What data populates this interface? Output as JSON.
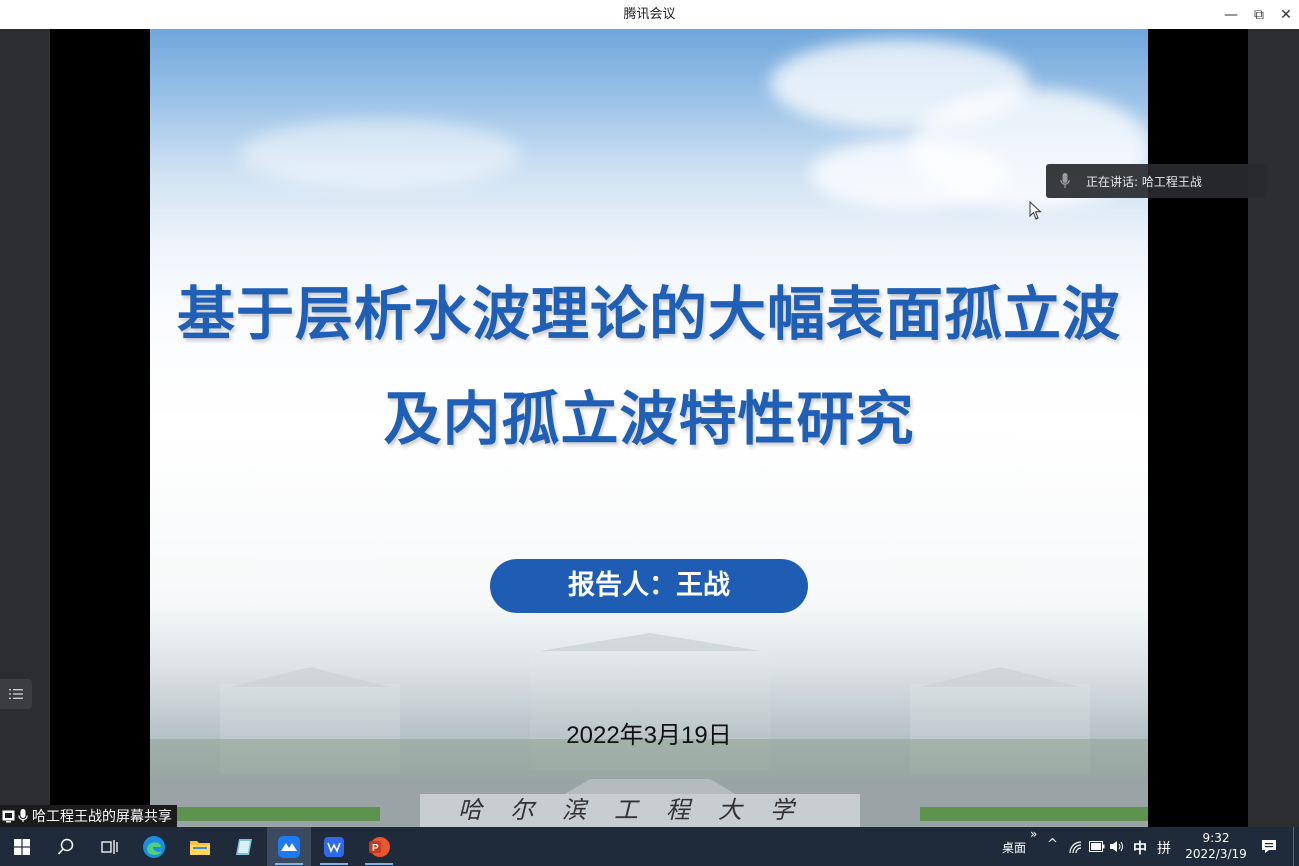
{
  "window": {
    "title": "腾讯会议",
    "minimize_glyph": "—",
    "maximize_glyph": "⧉",
    "close_glyph": "✕"
  },
  "slide": {
    "title_line1": "基于层析水波理论的大幅表面孤立波",
    "title_line2": "及内孤立波特性研究",
    "reporter": "报告人：王战",
    "date": "2022年3月19日",
    "campus_sign": "哈尔滨工程大学",
    "title_color": "#1f5fb5",
    "pill_color": "#1e5db3"
  },
  "meeting": {
    "speaking_text": "正在讲话: 哈工程王战",
    "share_label": "哈工程王战的屏幕共享"
  },
  "taskbar": {
    "desktop_label": "桌面",
    "expand_glyph": "»",
    "tray_up_glyph": "^",
    "ime_lang": "中",
    "ime_mode": "拼",
    "time": "9:32",
    "date": "2022/3/19"
  }
}
